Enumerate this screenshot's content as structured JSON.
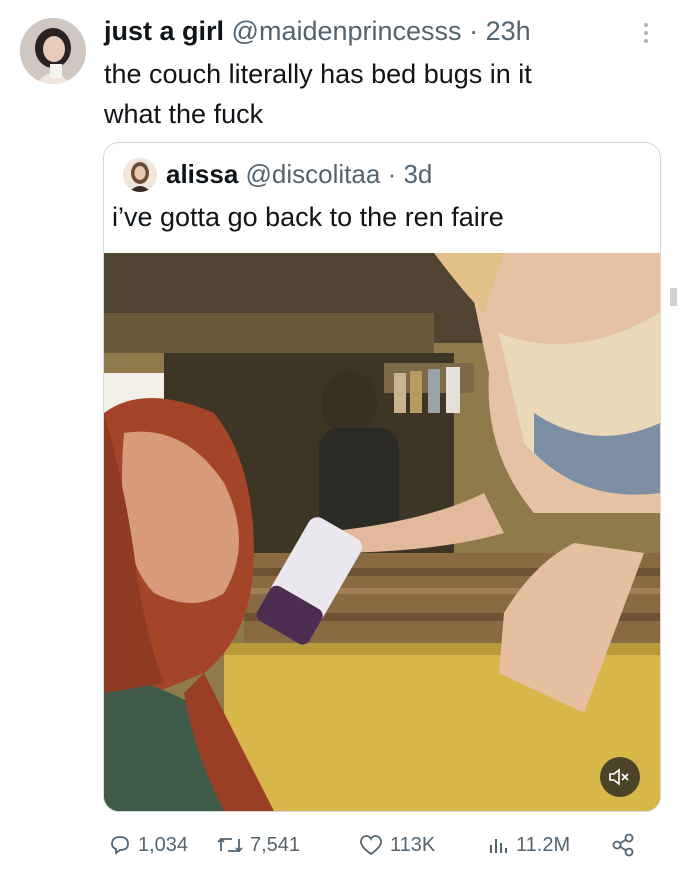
{
  "tweet": {
    "author": {
      "display_name": "just a girl",
      "handle": "@maidenprincesss",
      "time": "· 23h"
    },
    "text_line1": "the couch literally has bed bugs in it",
    "text_line2": "what the fuck"
  },
  "quoted_tweet": {
    "author": {
      "display_name": "alissa",
      "handle": "@discolitaa",
      "time": "· 3d"
    },
    "text": "i’ve gotta go back to the ren faire",
    "media": {
      "type": "video",
      "muted_icon": "volume-muted-icon"
    }
  },
  "actions": {
    "replies": "1,034",
    "retweets": "7,541",
    "likes": "113K",
    "views": "11.2M"
  },
  "colors": {
    "text": "#0f1419",
    "secondary": "#536471",
    "border": "#cfd9de"
  }
}
